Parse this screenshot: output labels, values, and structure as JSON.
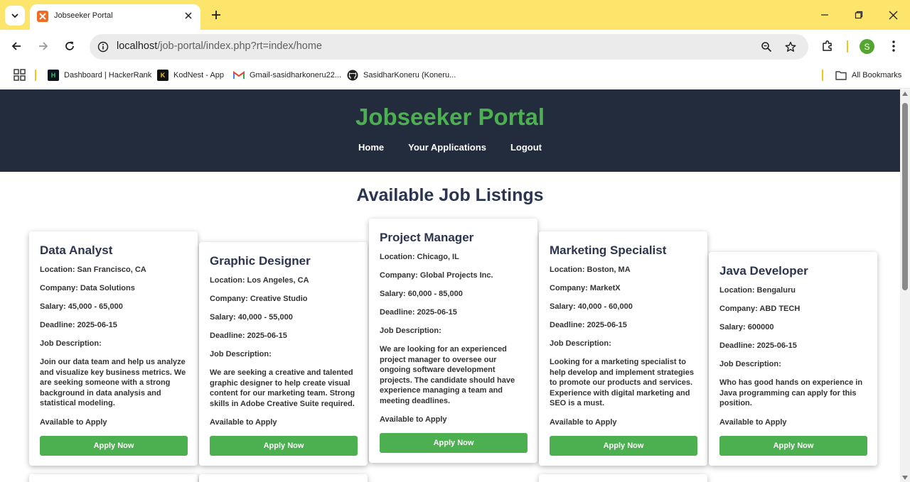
{
  "browser": {
    "tab_title": "Jobseeker Portal",
    "url_host": "localhost",
    "url_path": "/job-portal/index.php?rt=index/home",
    "profile_initial": "S",
    "bookmarks": [
      {
        "label": "Dashboard | HackerRank",
        "icon": "hackerrank-icon"
      },
      {
        "label": "KodNest - App",
        "icon": "kodnest-icon"
      },
      {
        "label": "Gmail-sasidharkoneru22...",
        "icon": "gmail-icon"
      },
      {
        "label": "SasidharKoneru (Koneru...",
        "icon": "github-icon"
      }
    ],
    "all_bookmarks_label": "All Bookmarks",
    "colors": {
      "tabbar": "#fde46b",
      "omnibox": "#ebebeb"
    }
  },
  "site": {
    "title": "Jobseeker Portal",
    "nav": [
      "Home",
      "Your Applications",
      "Logout"
    ],
    "listing_heading": "Available Job Listings",
    "colors": {
      "header_bg": "#222c3c",
      "title": "#4caf50",
      "heading": "#2b3550",
      "button": "#4caf50"
    }
  },
  "jobs": [
    {
      "title": "Data Analyst",
      "location": "Location: San Francisco, CA",
      "company": "Company: Data Solutions",
      "salary": "Salary: 45,000 - 65,000",
      "deadline": "Deadline: 2025-06-15",
      "desc_label": "Job Description:",
      "description": "Join our data team and help us analyze and visualize key business metrics. We are seeking someone with a strong background in data analysis and statistical modeling.",
      "status": "Available to Apply",
      "button": "Apply Now"
    },
    {
      "title": "Graphic Designer",
      "location": "Location: Los Angeles, CA",
      "company": "Company: Creative Studio",
      "salary": "Salary: 40,000 - 55,000",
      "deadline": "Deadline: 2025-06-15",
      "desc_label": "Job Description:",
      "description": "We are seeking a creative and talented graphic designer to help create visual content for our marketing team. Strong skills in Adobe Creative Suite required.",
      "status": "Available to Apply",
      "button": "Apply Now"
    },
    {
      "title": "Project Manager",
      "location": "Location: Chicago, IL",
      "company": "Company: Global Projects Inc.",
      "salary": "Salary: 60,000 - 85,000",
      "deadline": "Deadline: 2025-06-15",
      "desc_label": "Job Description:",
      "description": "We are looking for an experienced project manager to oversee our ongoing software development projects. The candidate should have experience managing a team and meeting deadlines.",
      "status": "Available to Apply",
      "button": "Apply Now"
    },
    {
      "title": "Marketing Specialist",
      "location": "Location: Boston, MA",
      "company": "Company: MarketX",
      "salary": "Salary: 40,000 - 60,000",
      "deadline": "Deadline: 2025-06-15",
      "desc_label": "Job Description:",
      "description": "Looking for a marketing specialist to help develop and implement strategies to promote our products and services. Experience with digital marketing and SEO is a must.",
      "status": "Available to Apply",
      "button": "Apply Now"
    },
    {
      "title": "Java Developer",
      "location": "Location: Bengaluru",
      "company": "Company: ABD TECH",
      "salary": "Salary: 600000",
      "deadline": "Deadline: 2025-06-15",
      "desc_label": "Job Description:",
      "description": "Who has good hands on experience in Java programming can apply for this position.",
      "status": "Available to Apply",
      "button": "Apply Now"
    }
  ]
}
